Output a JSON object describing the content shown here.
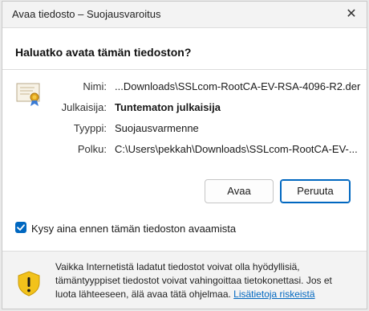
{
  "window": {
    "title": "Avaa tiedosto – Suojausvaroitus",
    "close_glyph": "✕"
  },
  "dialog": {
    "question": "Haluatko avata tämän tiedoston?",
    "info": [
      {
        "label": "Nimi:",
        "value": "...Downloads\\SSLcom-RootCA-EV-RSA-4096-R2.der",
        "bold": false
      },
      {
        "label": "Julkaisija:",
        "value": "Tuntematon julkaisija",
        "bold": true
      },
      {
        "label": "Tyyppi:",
        "value": "Suojausvarmenne",
        "bold": false
      },
      {
        "label": "Polku:",
        "value": "C:\\Users\\pekkah\\Downloads\\SSLcom-RootCA-EV-...",
        "bold": false
      }
    ],
    "buttons": {
      "open_label": "Avaa",
      "cancel_label": "Peruuta"
    },
    "checkbox": {
      "label": "Kysy aina ennen tämän tiedoston avaamista",
      "checked": true
    }
  },
  "footer": {
    "warning_text": "Vaikka Internetistä ladatut tiedostot voivat olla hyödyllisiä, tämäntyyppiset tiedostot voivat vahingoittaa tietokonettasi. Jos et luota lähteeseen, älä avaa tätä ohjelmaa.",
    "link_text": "Lisätietoja riskeistä"
  },
  "icons": {
    "certificate": "certificate-icon",
    "warning": "shield-warning-icon",
    "check": "checkmark-icon"
  },
  "colors": {
    "accent": "#0067c0",
    "warning_shield": "#f2c21b"
  }
}
